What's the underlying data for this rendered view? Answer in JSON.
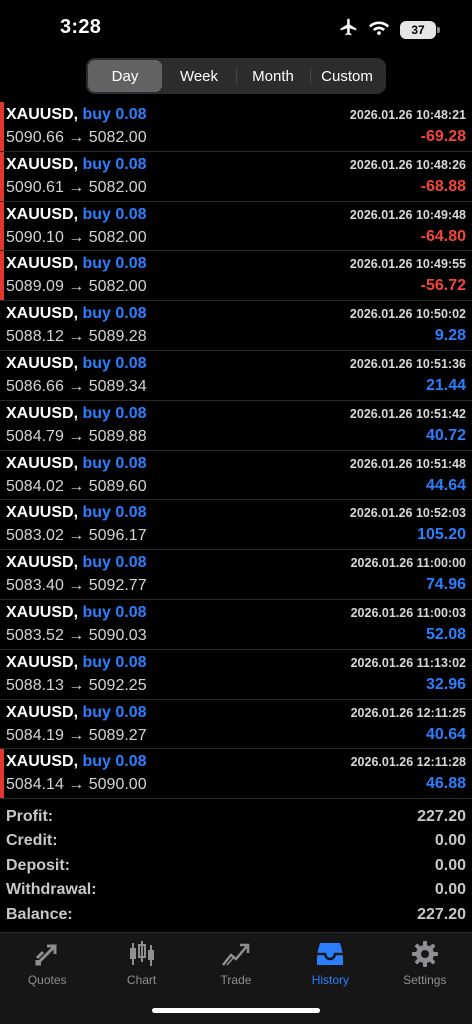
{
  "status": {
    "time": "3:28",
    "battery": "37"
  },
  "segmented": {
    "items": [
      "Day",
      "Week",
      "Month",
      "Custom"
    ],
    "active": "Day"
  },
  "trades": [
    {
      "symbol": "XAUUSD,",
      "side": "buy 0.08",
      "open": "5090.66",
      "close": "5082.00",
      "date": "2026.01.26 10:48:21",
      "profit": "-69.28",
      "negative": true
    },
    {
      "symbol": "XAUUSD,",
      "side": "buy 0.08",
      "open": "5090.61",
      "close": "5082.00",
      "date": "2026.01.26 10:48:26",
      "profit": "-68.88",
      "negative": true
    },
    {
      "symbol": "XAUUSD,",
      "side": "buy 0.08",
      "open": "5090.10",
      "close": "5082.00",
      "date": "2026.01.26 10:49:48",
      "profit": "-64.80",
      "negative": true
    },
    {
      "symbol": "XAUUSD,",
      "side": "buy 0.08",
      "open": "5089.09",
      "close": "5082.00",
      "date": "2026.01.26 10:49:55",
      "profit": "-56.72",
      "negative": true
    },
    {
      "symbol": "XAUUSD,",
      "side": "buy 0.08",
      "open": "5088.12",
      "close": "5089.28",
      "date": "2026.01.26 10:50:02",
      "profit": "9.28",
      "negative": false
    },
    {
      "symbol": "XAUUSD,",
      "side": "buy 0.08",
      "open": "5086.66",
      "close": "5089.34",
      "date": "2026.01.26 10:51:36",
      "profit": "21.44",
      "negative": false
    },
    {
      "symbol": "XAUUSD,",
      "side": "buy 0.08",
      "open": "5084.79",
      "close": "5089.88",
      "date": "2026.01.26 10:51:42",
      "profit": "40.72",
      "negative": false
    },
    {
      "symbol": "XAUUSD,",
      "side": "buy 0.08",
      "open": "5084.02",
      "close": "5089.60",
      "date": "2026.01.26 10:51:48",
      "profit": "44.64",
      "negative": false
    },
    {
      "symbol": "XAUUSD,",
      "side": "buy 0.08",
      "open": "5083.02",
      "close": "5096.17",
      "date": "2026.01.26 10:52:03",
      "profit": "105.20",
      "negative": false
    },
    {
      "symbol": "XAUUSD,",
      "side": "buy 0.08",
      "open": "5083.40",
      "close": "5092.77",
      "date": "2026.01.26 11:00:00",
      "profit": "74.96",
      "negative": false
    },
    {
      "symbol": "XAUUSD,",
      "side": "buy 0.08",
      "open": "5083.52",
      "close": "5090.03",
      "date": "2026.01.26 11:00:03",
      "profit": "52.08",
      "negative": false
    },
    {
      "symbol": "XAUUSD,",
      "side": "buy 0.08",
      "open": "5088.13",
      "close": "5092.25",
      "date": "2026.01.26 11:13:02",
      "profit": "32.96",
      "negative": false
    },
    {
      "symbol": "XAUUSD,",
      "side": "buy 0.08",
      "open": "5084.19",
      "close": "5089.27",
      "date": "2026.01.26 12:11:25",
      "profit": "40.64",
      "negative": false
    },
    {
      "symbol": "XAUUSD,",
      "side": "buy 0.08",
      "open": "5084.14",
      "close": "5090.00",
      "date": "2026.01.26 12:11:28",
      "profit": "46.88",
      "negative": false
    }
  ],
  "summary": [
    {
      "label": "Profit:",
      "value": "227.20"
    },
    {
      "label": "Credit:",
      "value": "0.00"
    },
    {
      "label": "Deposit:",
      "value": "0.00"
    },
    {
      "label": "Withdrawal:",
      "value": "0.00"
    },
    {
      "label": "Balance:",
      "value": "227.20"
    }
  ],
  "tabs": [
    {
      "label": "Quotes",
      "icon": "quotes-icon"
    },
    {
      "label": "Chart",
      "icon": "candlestick-chart-icon"
    },
    {
      "label": "Trade",
      "icon": "trade-icon"
    },
    {
      "label": "History",
      "icon": "history-tray-icon"
    },
    {
      "label": "Settings",
      "icon": "gear-icon"
    }
  ],
  "active_tab": "History",
  "colors": {
    "accent": "#2b7fff",
    "loss": "#f4453a",
    "flag": "#e2372f"
  }
}
